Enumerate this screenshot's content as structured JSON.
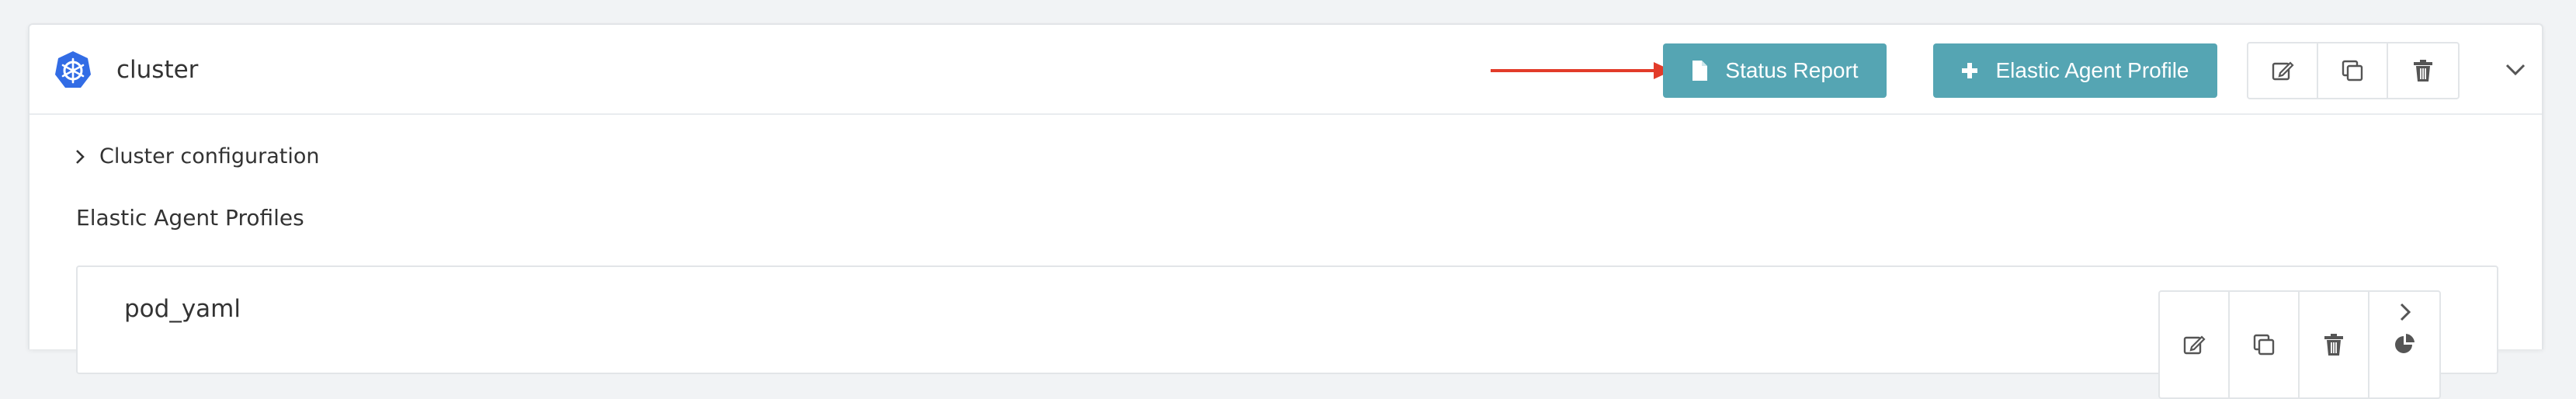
{
  "cluster": {
    "title": "cluster",
    "logo_icon": "kubernetes-icon"
  },
  "header_actions": {
    "status_report_label": "Status Report",
    "status_report_icon": "file-icon",
    "elastic_agent_profile_label": "Elastic Agent Profile",
    "elastic_agent_profile_icon": "plus-icon",
    "icons": [
      "edit-icon",
      "clone-icon",
      "delete-icon"
    ],
    "collapse_icon": "chevron-down-icon"
  },
  "colors": {
    "primary_button": "#55a5b3",
    "annotation_arrow": "#e23b2a",
    "kubernetes_blue": "#326ce5"
  },
  "cluster_configuration": {
    "label": "Cluster configuration",
    "icon": "chevron-right-icon"
  },
  "profiles_section": {
    "title": "Elastic Agent Profiles",
    "profiles": [
      {
        "name": "pod_yaml",
        "icons": [
          "edit-icon",
          "clone-icon",
          "delete-icon",
          "usage-pie-icon"
        ],
        "expand_icon": "chevron-right-icon"
      }
    ]
  }
}
